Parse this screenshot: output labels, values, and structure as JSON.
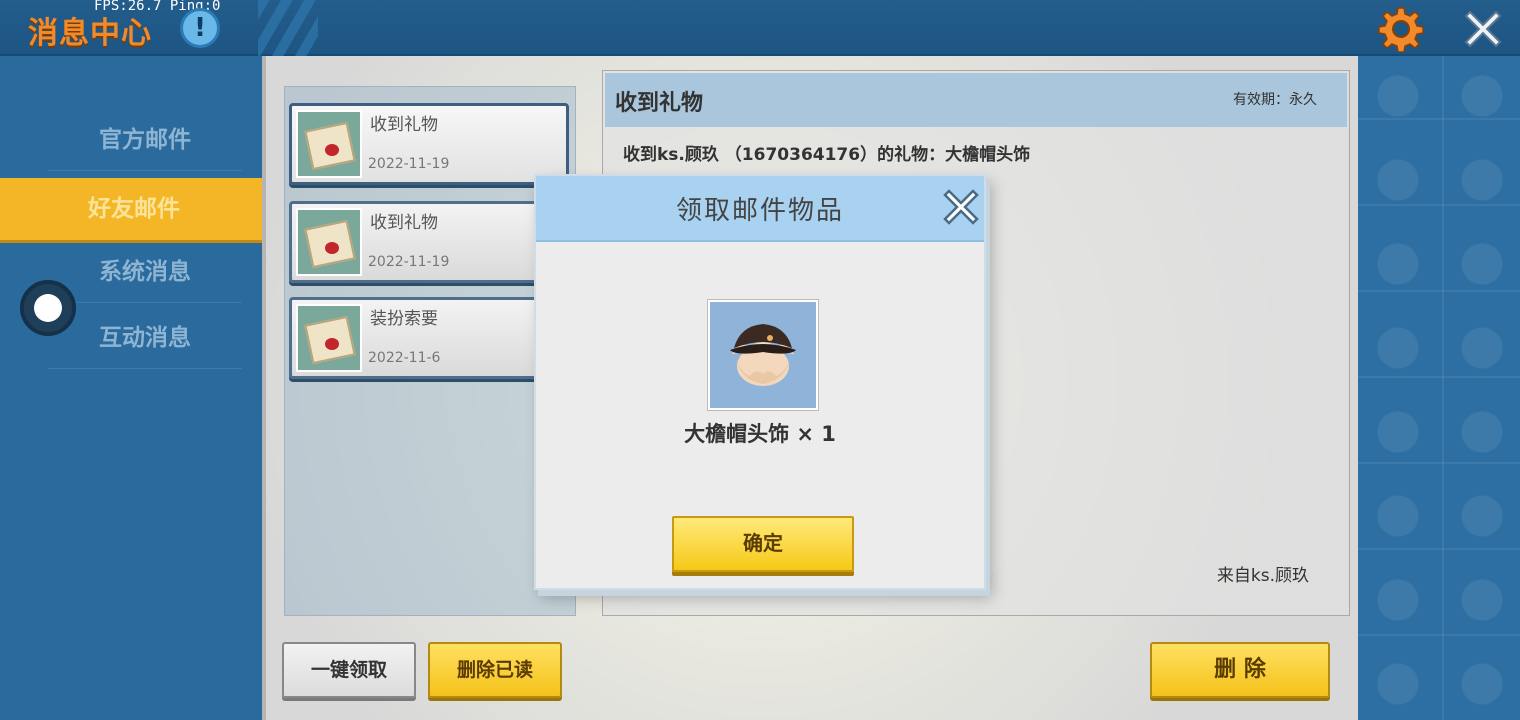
{
  "header": {
    "title": "消息中心",
    "fps": "FPS:26.7  Ping:0",
    "info_badge": "!"
  },
  "sidebar": {
    "items": [
      {
        "label": "官方邮件",
        "active": false
      },
      {
        "label": "好友邮件",
        "active": true
      },
      {
        "label": "系统消息",
        "active": false
      },
      {
        "label": "互动消息",
        "active": false
      }
    ]
  },
  "mail_list": [
    {
      "title": "收到礼物",
      "date": "2022-11-19"
    },
    {
      "title": "收到礼物",
      "date": "2022-11-19"
    },
    {
      "title": "装扮索要",
      "date": "2022-11-6"
    }
  ],
  "buttons": {
    "claim_all": "一键领取",
    "delete_read": "删除已读",
    "delete": "删 除"
  },
  "detail": {
    "title": "收到礼物",
    "expiry": "有效期：永久",
    "body": "收到ks.顾玖 （1670364176）的礼物：大檐帽头饰",
    "from": "来自ks.顾玖"
  },
  "modal": {
    "title": "领取邮件物品",
    "item_label": "大檐帽头饰 × 1",
    "confirm": "确定"
  },
  "colors": {
    "accent_orange": "#f08a2a",
    "active_tab": "#f4b626",
    "button_yellow": "#f6c917",
    "modal_header": "#a8d2f0"
  },
  "icons": {
    "settings": "gear-icon",
    "close": "close-icon",
    "mail": "envelope-icon"
  }
}
